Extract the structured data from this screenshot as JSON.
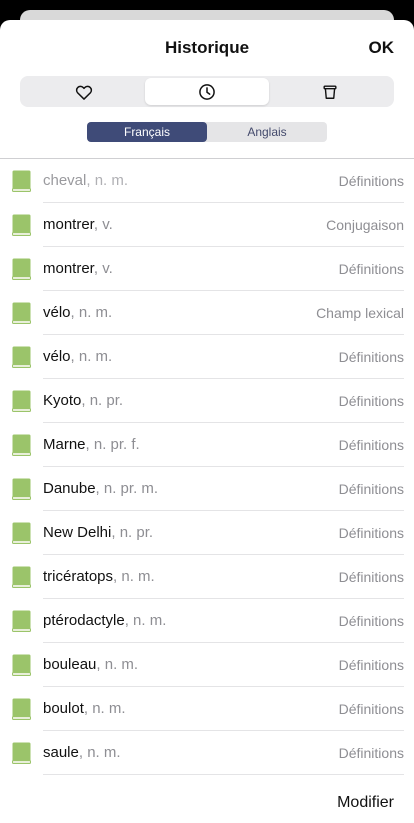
{
  "header": {
    "title": "Historique",
    "ok_label": "OK"
  },
  "segments": [
    {
      "icon": "heart-icon",
      "active": false
    },
    {
      "icon": "clock-icon",
      "active": true
    },
    {
      "icon": "trash-icon",
      "active": false
    }
  ],
  "languages": [
    {
      "label": "Français",
      "active": true
    },
    {
      "label": "Anglais",
      "active": false
    }
  ],
  "history": [
    {
      "word": "cheval",
      "gram": ", n. m.",
      "type": "Définitions",
      "faded": true
    },
    {
      "word": "montrer",
      "gram": ", v.",
      "type": "Conjugaison"
    },
    {
      "word": "montrer",
      "gram": ", v.",
      "type": "Définitions"
    },
    {
      "word": "vélo",
      "gram": ", n. m.",
      "type": "Champ lexical"
    },
    {
      "word": "vélo",
      "gram": ", n. m.",
      "type": "Définitions"
    },
    {
      "word": "Kyoto",
      "gram": ", n. pr.",
      "type": "Définitions"
    },
    {
      "word": "Marne",
      "gram": ", n. pr. f.",
      "type": "Définitions"
    },
    {
      "word": "Danube",
      "gram": ", n. pr. m.",
      "type": "Définitions"
    },
    {
      "word": "New Delhi",
      "gram": ", n. pr.",
      "type": "Définitions"
    },
    {
      "word": "tricératops",
      "gram": ", n. m.",
      "type": "Définitions"
    },
    {
      "word": "ptérodactyle",
      "gram": ", n. m.",
      "type": "Définitions"
    },
    {
      "word": "bouleau",
      "gram": ", n. m.",
      "type": "Définitions"
    },
    {
      "word": "boulot",
      "gram": ", n. m.",
      "type": "Définitions"
    },
    {
      "word": "saule",
      "gram": ", n. m.",
      "type": "Définitions"
    }
  ],
  "footer": {
    "edit_label": "Modifier"
  },
  "colors": {
    "accent": "#3f4b78",
    "book": "#9bc46a"
  }
}
